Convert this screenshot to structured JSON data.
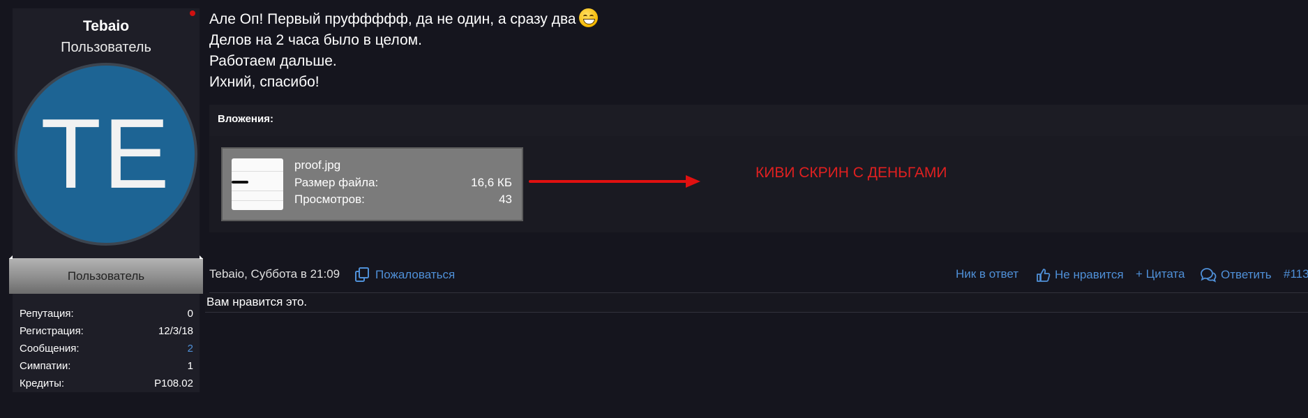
{
  "user": {
    "name": "Tebaio",
    "title": "Пользователь",
    "avatar_initials": "TE",
    "avatar_color": "#1d6494",
    "banner": "Пользователь",
    "stats": [
      {
        "label": "Репутация:",
        "value": "0"
      },
      {
        "label": "Регистрация:",
        "value": "12/3/18"
      },
      {
        "label": "Сообщения:",
        "value": "2"
      },
      {
        "label": "Симпатии:",
        "value": "1"
      },
      {
        "label": "Кредиты:",
        "value": "P108.02"
      }
    ]
  },
  "message": {
    "lines": [
      "Але Оп! Первый пруффффф, да не один, а сразу два",
      "Делов на 2 часа было в целом.",
      "Работаем дальше.",
      "Ихний, спасибо!"
    ],
    "emoji_icon": "grin-smiley-icon"
  },
  "attachments": {
    "title": "Вложения:",
    "file": {
      "name": "proof.jpg",
      "size_label": "Размер файла:",
      "size_value": "16,6 КБ",
      "views_label": "Просмотров:",
      "views_value": "43"
    }
  },
  "annotation": {
    "text": "КИВИ СКРИН С ДЕНЬГАМИ",
    "color": "#e02020"
  },
  "footer": {
    "author_date": "Tebaio, Суббота в 21:09",
    "report": "Пожаловаться",
    "nick_reply": "Ник в ответ",
    "dislike": "Не нравится",
    "quote": "+ Цитата",
    "reply": "Ответить",
    "post_number": "#113",
    "likes_text": "Вам нравится это.",
    "link_color": "#4f90d8"
  }
}
